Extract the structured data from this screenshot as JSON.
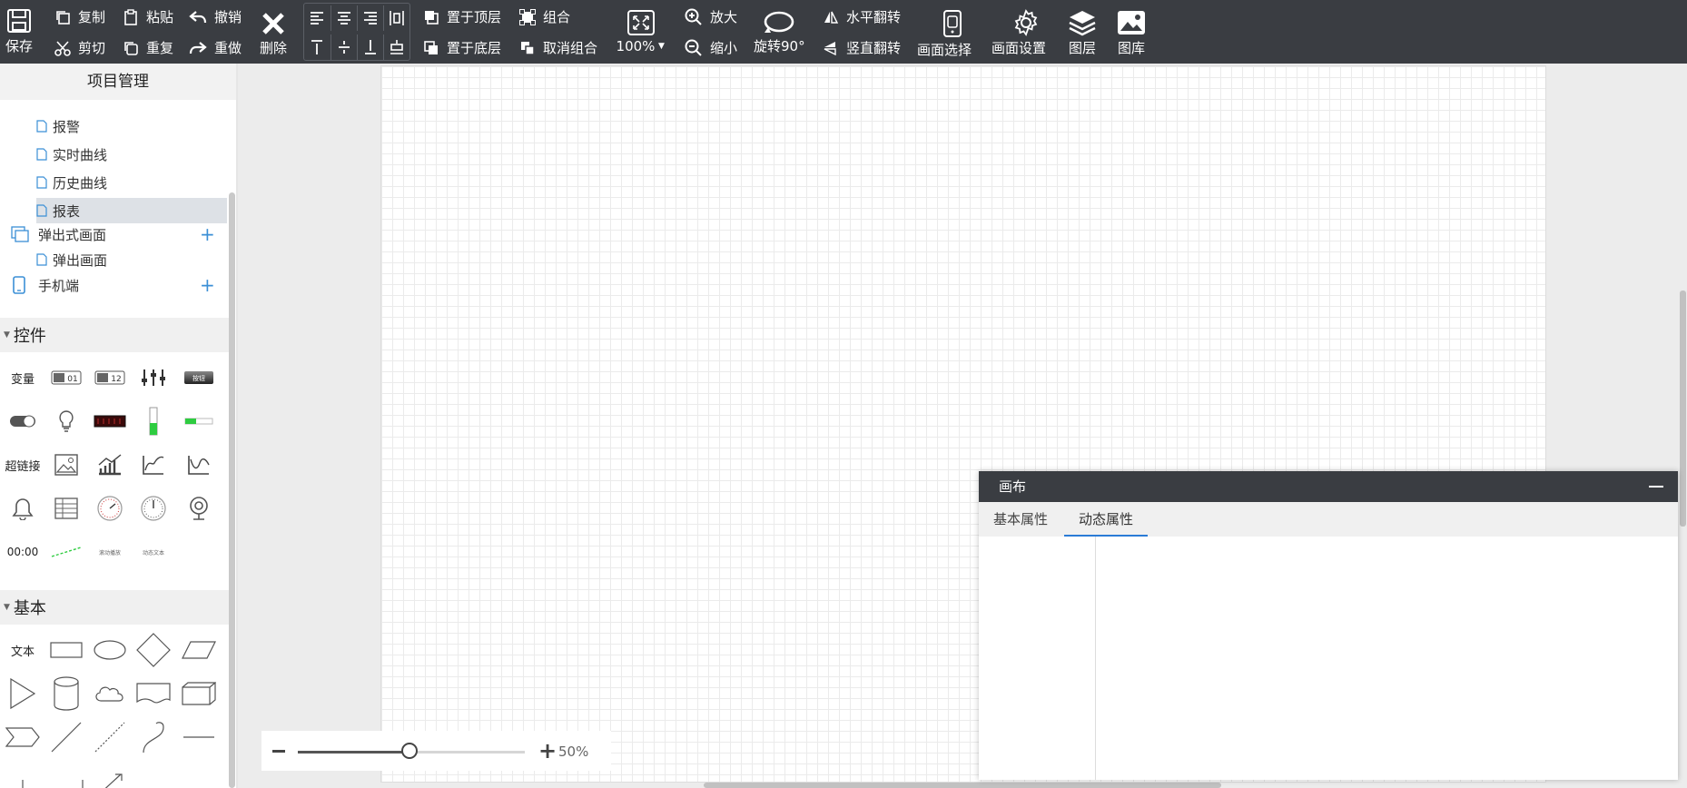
{
  "toolbar": {
    "save": "保存",
    "copy": "复制",
    "cut": "剪切",
    "paste": "粘贴",
    "repeat": "重复",
    "undo": "撤销",
    "redo": "重做",
    "delete": "删除",
    "bring_to_top": "置于顶层",
    "send_to_bottom": "置于底层",
    "group": "组合",
    "ungroup": "取消组合",
    "zoom_level": "100%",
    "zoom_in": "放大",
    "zoom_out": "缩小",
    "rotate": "旋转90°",
    "flip_horizontal": "水平翻转",
    "flip_vertical": "竖直翻转",
    "screen_select": "画面选择",
    "screen_settings": "画面设置",
    "layers": "图层",
    "gallery": "图库"
  },
  "project": {
    "title": "项目管理",
    "items": [
      {
        "label": "报警"
      },
      {
        "label": "实时曲线"
      },
      {
        "label": "历史曲线"
      },
      {
        "label": "报表"
      },
      {
        "label": "弹出式画面"
      },
      {
        "label": "弹出画面"
      },
      {
        "label": "手机端"
      }
    ]
  },
  "controls": {
    "title": "控件",
    "variable": "变量",
    "hyperlink": "超链接",
    "time": "00:00",
    "btn01": "01",
    "btn12": "12",
    "button": "按钮",
    "scroll_text": "滚动播放",
    "dynamic_text": "动态文本"
  },
  "basic": {
    "title": "基本",
    "text": "文本"
  },
  "zoom": {
    "value": "50%",
    "fraction": 0.5
  },
  "properties": {
    "title": "画布",
    "tabs": [
      "基本属性",
      "动态属性"
    ],
    "active_tab": 1
  },
  "colors": {
    "toolbar_bg": "#3a3d42",
    "accent": "#2a7bd6",
    "plus": "#3b8fd6"
  }
}
